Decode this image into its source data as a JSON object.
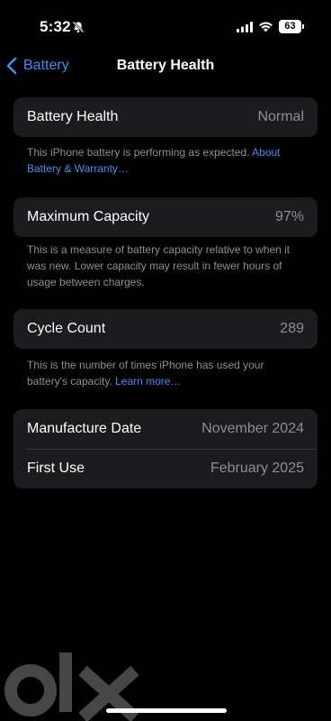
{
  "status": {
    "time": "5:32",
    "battery_level": "63",
    "icons": [
      "bell-slash-icon",
      "signal-icon",
      "wifi-icon",
      "battery-icon"
    ]
  },
  "nav": {
    "back_label": "Battery",
    "title": "Battery Health"
  },
  "sections": {
    "health": {
      "label": "Battery Health",
      "value": "Normal",
      "footnote": "This iPhone battery is performing as expected. ",
      "link": "About Battery & Warranty…"
    },
    "capacity": {
      "label": "Maximum Capacity",
      "value": "97%",
      "footnote": "This is a measure of battery capacity relative to when it was new. Lower capacity may result in fewer hours of usage between charges."
    },
    "cycles": {
      "label": "Cycle Count",
      "value": "289",
      "footnote": "This is the number of times iPhone has used your battery's capacity. ",
      "link": "Learn more…"
    },
    "dates": {
      "manufacture_label": "Manufacture Date",
      "manufacture_value": "November 2024",
      "first_use_label": "First Use",
      "first_use_value": "February 2025"
    }
  },
  "watermark": {
    "text": "olx"
  },
  "colors": {
    "background": "#000000",
    "card": "#1c1c1e",
    "accent": "#3d8ef8",
    "secondary_text": "#8e8e93"
  }
}
